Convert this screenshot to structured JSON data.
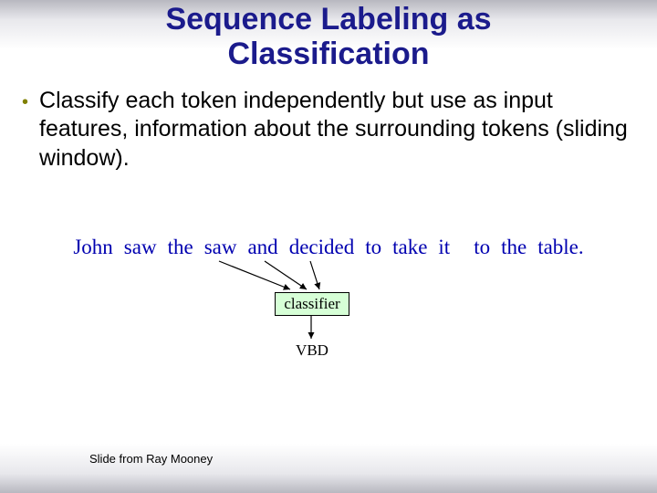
{
  "title_line1": "Sequence Labeling as",
  "title_line2": "Classification",
  "bullet": "Classify each token independently but use as input features, information about the surrounding tokens (sliding window).",
  "tokens": {
    "t0": "John",
    "t1": "saw",
    "t2": "the",
    "t3": "saw",
    "t4": "and",
    "t5": "decided",
    "t6": "to",
    "t7": "take",
    "t8": "it",
    "t9": "to",
    "t10": "the",
    "t11": "table."
  },
  "classifier_label": "classifier",
  "output_tag": "VBD",
  "attribution": "Slide from Ray Mooney",
  "colors": {
    "title": "#1b1b8c",
    "bullet_marker": "#808000",
    "token": "#0000b0",
    "classifier_bg": "#d6ffd6"
  }
}
